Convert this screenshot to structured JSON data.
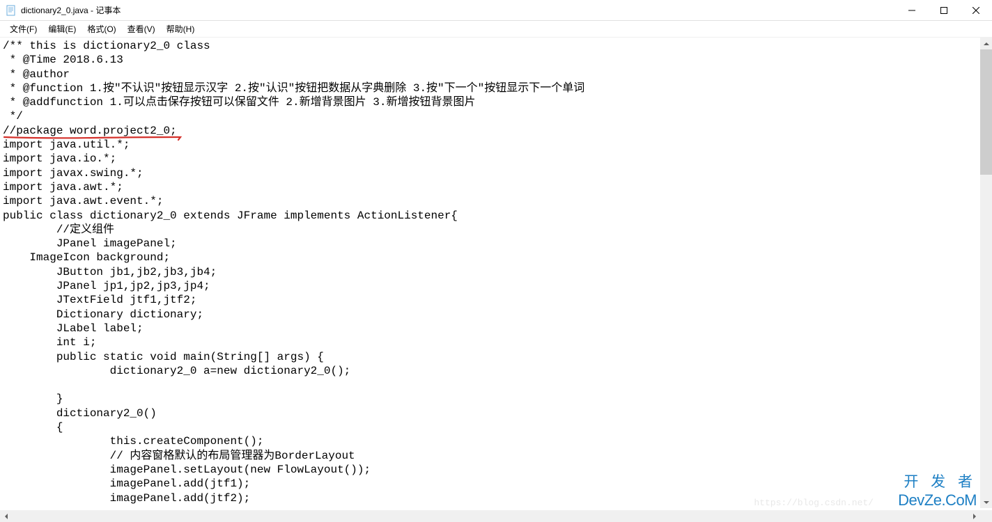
{
  "window": {
    "title": "dictionary2_0.java - 记事本"
  },
  "menu": {
    "file": "文件(F)",
    "edit": "编辑(E)",
    "format": "格式(O)",
    "view": "查看(V)",
    "help": "帮助(H)"
  },
  "editor": {
    "content": "/** this is dictionary2_0 class\n * @Time 2018.6.13\n * @author \n * @function 1.按\"不认识\"按钮显示汉字 2.按\"认识\"按钮把数据从字典删除 3.按\"下一个\"按钮显示下一个单词\n * @addfunction 1.可以点击保存按钮可以保留文件 2.新增背景图片 3.新增按钮背景图片\n */\n//package word.project2_0;\nimport java.util.*;\nimport java.io.*;\nimport javax.swing.*;\nimport java.awt.*;\nimport java.awt.event.*;\npublic class dictionary2_0 extends JFrame implements ActionListener{\n        //定义组件\n        JPanel imagePanel;\n    ImageIcon background;\n        JButton jb1,jb2,jb3,jb4;\n        JPanel jp1,jp2,jp3,jp4;\n        JTextField jtf1,jtf2;\n        Dictionary dictionary;\n        JLabel label;\n        int i;\n        public static void main(String[] args) {\n                dictionary2_0 a=new dictionary2_0();\n\n        }\n        dictionary2_0()\n        {\n                this.createComponent();\n                // 内容窗格默认的布局管理器为BorderLayout\n                imagePanel.setLayout(new FlowLayout());\n                imagePanel.add(jtf1);\n                imagePanel.add(jtf2);"
  },
  "watermark": {
    "top": "开 发 者",
    "bottom": "DevZe.CoM",
    "url": "https://blog.csdn.net/"
  }
}
